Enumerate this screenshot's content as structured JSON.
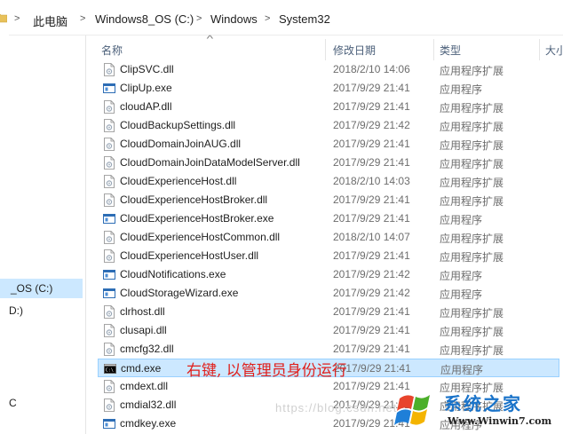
{
  "breadcrumb": {
    "items": [
      "此电脑",
      "Windows8_OS (C:)",
      "Windows",
      "System32"
    ],
    "separator": ">"
  },
  "nav": {
    "items": [
      "_OS (C:)",
      "D:)",
      "C"
    ]
  },
  "columns": {
    "name": "名称",
    "date": "修改日期",
    "type": "类型",
    "size": "大小"
  },
  "files": [
    {
      "name": "ClipSVC.dll",
      "date": "2018/2/10 14:06",
      "type": "应用程序扩展",
      "icon": "dll-icon"
    },
    {
      "name": "ClipUp.exe",
      "date": "2017/9/29 21:41",
      "type": "应用程序",
      "icon": "exe-icon"
    },
    {
      "name": "cloudAP.dll",
      "date": "2017/9/29 21:41",
      "type": "应用程序扩展",
      "icon": "dll-icon"
    },
    {
      "name": "CloudBackupSettings.dll",
      "date": "2017/9/29 21:42",
      "type": "应用程序扩展",
      "icon": "dll-icon"
    },
    {
      "name": "CloudDomainJoinAUG.dll",
      "date": "2017/9/29 21:41",
      "type": "应用程序扩展",
      "icon": "dll-icon"
    },
    {
      "name": "CloudDomainJoinDataModelServer.dll",
      "date": "2017/9/29 21:41",
      "type": "应用程序扩展",
      "icon": "dll-icon"
    },
    {
      "name": "CloudExperienceHost.dll",
      "date": "2018/2/10 14:03",
      "type": "应用程序扩展",
      "icon": "dll-icon"
    },
    {
      "name": "CloudExperienceHostBroker.dll",
      "date": "2017/9/29 21:41",
      "type": "应用程序扩展",
      "icon": "dll-icon"
    },
    {
      "name": "CloudExperienceHostBroker.exe",
      "date": "2017/9/29 21:41",
      "type": "应用程序",
      "icon": "exe-icon"
    },
    {
      "name": "CloudExperienceHostCommon.dll",
      "date": "2018/2/10 14:07",
      "type": "应用程序扩展",
      "icon": "dll-icon"
    },
    {
      "name": "CloudExperienceHostUser.dll",
      "date": "2017/9/29 21:41",
      "type": "应用程序扩展",
      "icon": "dll-icon"
    },
    {
      "name": "CloudNotifications.exe",
      "date": "2017/9/29 21:42",
      "type": "应用程序",
      "icon": "exe-icon"
    },
    {
      "name": "CloudStorageWizard.exe",
      "date": "2017/9/29 21:42",
      "type": "应用程序",
      "icon": "exe-icon"
    },
    {
      "name": "clrhost.dll",
      "date": "2017/9/29 21:41",
      "type": "应用程序扩展",
      "icon": "dll-icon"
    },
    {
      "name": "clusapi.dll",
      "date": "2017/9/29 21:41",
      "type": "应用程序扩展",
      "icon": "dll-icon"
    },
    {
      "name": "cmcfg32.dll",
      "date": "2017/9/29 21:41",
      "type": "应用程序扩展",
      "icon": "dll-icon"
    },
    {
      "name": "cmd.exe",
      "date": "2017/9/29 21:41",
      "type": "应用程序",
      "icon": "cmd-icon",
      "selected": true
    },
    {
      "name": "cmdext.dll",
      "date": "2017/9/29 21:41",
      "type": "应用程序扩展",
      "icon": "dll-icon"
    },
    {
      "name": "cmdial32.dll",
      "date": "2017/9/29 21:41",
      "type": "应用程序扩展",
      "icon": "dll-icon"
    },
    {
      "name": "cmdkey.exe",
      "date": "2017/9/29 21:41",
      "type": "应用程序",
      "icon": "exe-icon"
    }
  ],
  "annotation": "右键, 以管理员身份运行",
  "watermark": {
    "url_text": "https://blog.csdn.net",
    "site_name": "系统之家",
    "site_url": "Www.Winwin7.com"
  },
  "colors": {
    "selection": "#cce8ff",
    "annotation": "#e0201c",
    "header_text": "#4c607a"
  }
}
